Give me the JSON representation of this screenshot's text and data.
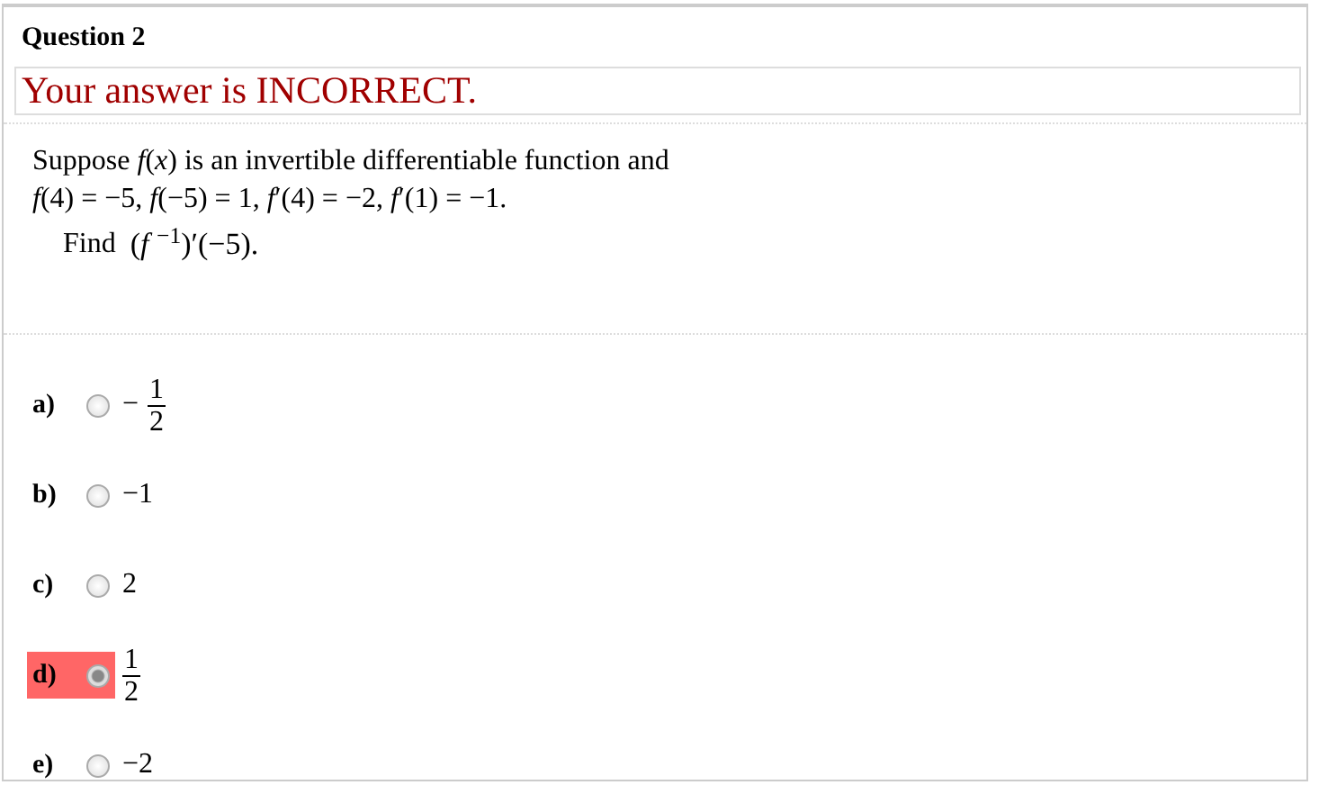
{
  "question": {
    "title": "Question 2"
  },
  "feedback": "Your answer is INCORRECT.",
  "prompt": [
    "Suppose *f*(*x*) is an invertible differentiable function and",
    "*f*(4) = −5,  *f*(−5) = 1,  *f*′(4) = −2,  *f*′(1) = −1."
  ],
  "find": {
    "label": "Find",
    "expression": "(*f* $^{−1}$)′(−5)."
  },
  "options": [
    {
      "letter": "a)",
      "kind": "fraction",
      "sign": "−",
      "numerator": "1",
      "denominator": "2",
      "selected": false
    },
    {
      "letter": "b)",
      "kind": "plain",
      "value": "−1",
      "selected": false
    },
    {
      "letter": "c)",
      "kind": "plain",
      "value": "2",
      "selected": false
    },
    {
      "letter": "d)",
      "kind": "fraction",
      "numerator": "1",
      "denominator": "2",
      "selected": true
    },
    {
      "letter": "e)",
      "kind": "plain",
      "value": "−2",
      "selected": false
    }
  ]
}
